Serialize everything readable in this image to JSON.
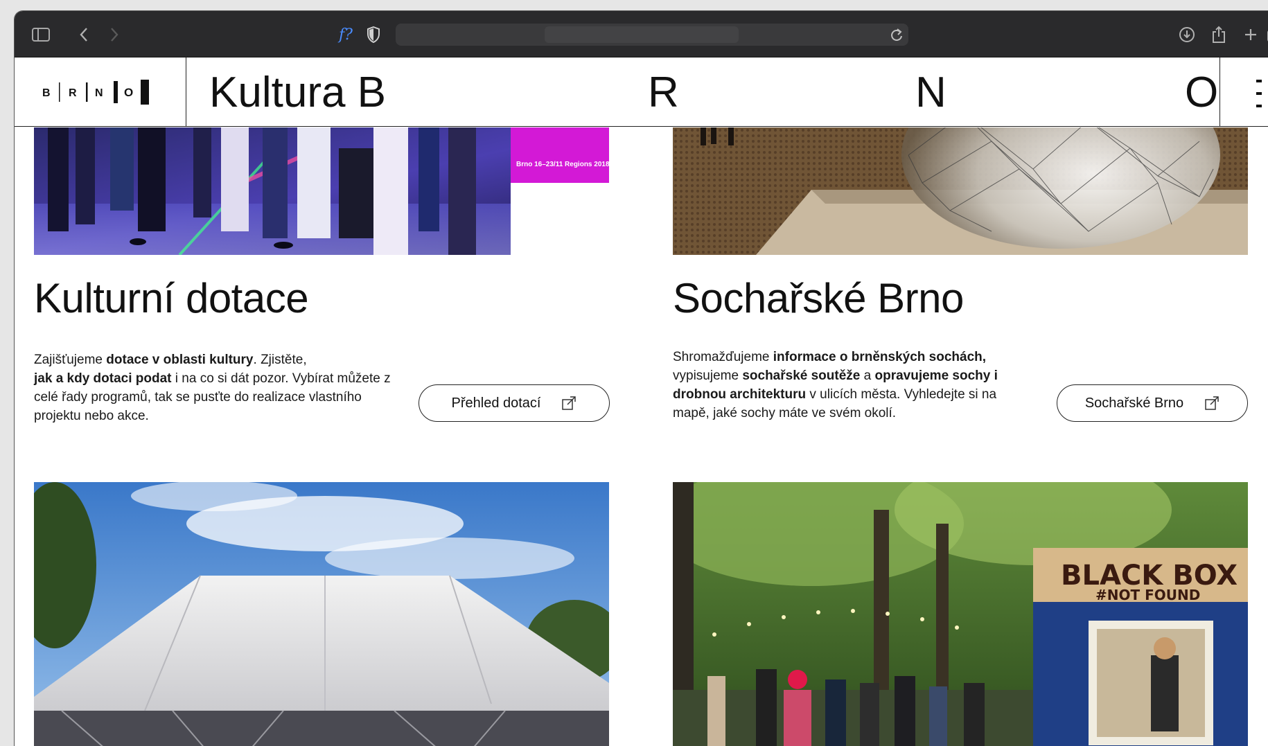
{
  "browser": {
    "icons": [
      "sidebar-icon",
      "back-icon",
      "forward-icon",
      "formula-icon",
      "shield-icon",
      "reload-icon",
      "download-icon",
      "share-icon",
      "new-tab-icon",
      "tabs-icon"
    ],
    "formula_label": "f?"
  },
  "header": {
    "logo_letters": [
      "B",
      "R",
      "N",
      "O"
    ],
    "title": "Kultura B",
    "title_letters": [
      "R",
      "N",
      "O"
    ],
    "menu_icon": "hamburger-icon"
  },
  "cards": [
    {
      "title": "Kulturní dotace",
      "text_parts": [
        {
          "t": "Zajišťujeme ",
          "b": false
        },
        {
          "t": "dotace v oblasti kultury",
          "b": true
        },
        {
          "t": ". Zjistěte, ",
          "b": false
        },
        {
          "t": "jak a kdy dotaci podat",
          "b": true
        },
        {
          "t": " i na co si dát pozor. Vybírat můžete z celé řady programů, tak se pusťte do realizace vlastního projektu nebo akce.",
          "b": false
        }
      ],
      "button": "Přehled dotací",
      "image_overlay": "Brno 16–23/11 Regions 2018"
    },
    {
      "title": "Sochařské Brno",
      "text_parts": [
        {
          "t": "Shromažďujeme ",
          "b": false
        },
        {
          "t": "informace o brněnských sochách,",
          "b": true
        },
        {
          "t": " vypisujeme ",
          "b": false
        },
        {
          "t": "sochařské soutěže",
          "b": true
        },
        {
          "t": " a ",
          "b": false
        },
        {
          "t": "opravujeme sochy i drobnou architekturu",
          "b": true
        },
        {
          "t": " v ulicích města. Vyhledejte si na mapě, jaké sochy máte ve svém okolí.",
          "b": false
        }
      ],
      "button": "Sochařské Brno"
    }
  ],
  "lower_photos": [
    {
      "name": "tent-photo"
    },
    {
      "name": "black-box-photo",
      "sign_line1": "BLACK BOX",
      "sign_line2": "#NOT FOUND"
    }
  ],
  "colors": {
    "toolbar": "#2a2a2c",
    "text": "#111111",
    "accent_magenta": "#d319d6"
  }
}
